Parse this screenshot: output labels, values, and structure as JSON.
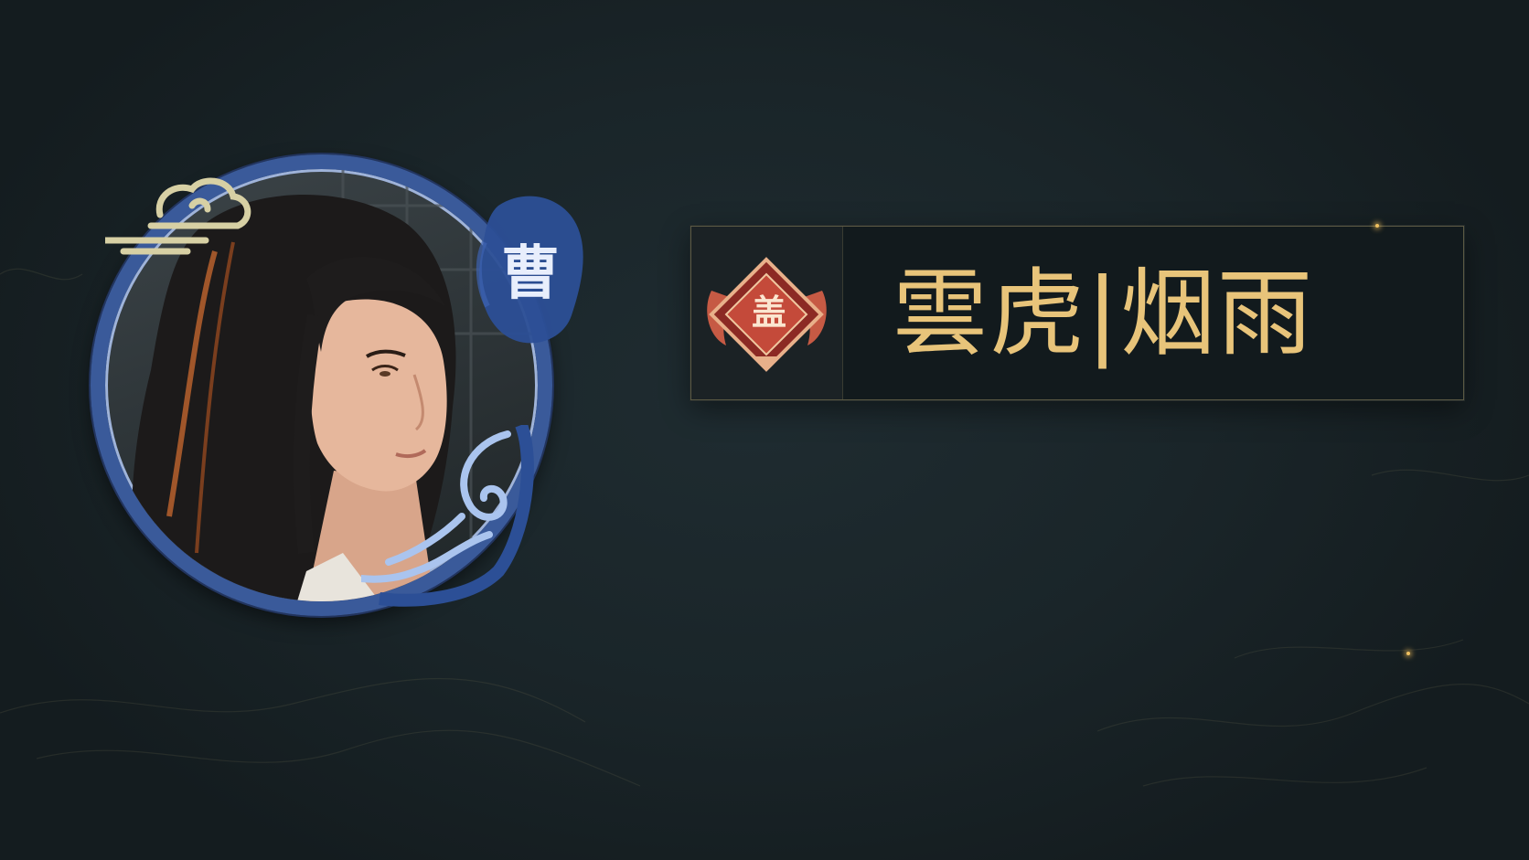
{
  "character": {
    "clan_character": "曹",
    "portrait_alt": "character-portrait"
  },
  "banner": {
    "emblem_character": "盖",
    "title": "雲虎|烟雨"
  },
  "colors": {
    "background": "#1a2428",
    "title_gold": "#e8c47a",
    "frame_blue": "#3a5a9a",
    "emblem_red": "#b8473a"
  },
  "icons": {
    "emblem": "red-diamond-crest-icon",
    "cloud": "cloud-swirl-icon",
    "wave": "wave-ornament-icon"
  }
}
